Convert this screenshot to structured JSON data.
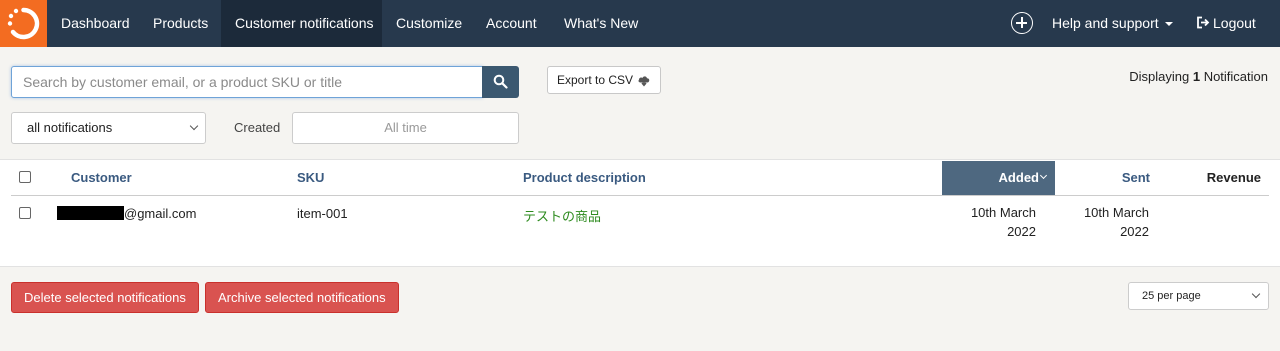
{
  "nav": {
    "items": [
      {
        "label": "Dashboard"
      },
      {
        "label": "Products"
      },
      {
        "label": "Customer notifications"
      },
      {
        "label": "Customize"
      },
      {
        "label": "Account"
      },
      {
        "label": "What's New"
      }
    ],
    "active_index": 2,
    "help_label": "Help and support",
    "logout_label": "Logout"
  },
  "toolbar": {
    "search_placeholder": "Search by customer email, or a product SKU or title",
    "export_label": "Export to CSV",
    "displaying_prefix": "Displaying",
    "displaying_count": "1",
    "displaying_suffix": "Notification"
  },
  "filters": {
    "notification_filter": "all notifications",
    "created_label": "Created",
    "date_range": "All time"
  },
  "table": {
    "columns": {
      "customer": "Customer",
      "sku": "SKU",
      "product_description": "Product description",
      "added": "Added",
      "sent": "Sent",
      "revenue": "Revenue"
    },
    "sorted_column": "added",
    "rows": [
      {
        "customer_email": "@gmail.com",
        "sku": "item-001",
        "product_description": "テストの商品",
        "added_line1": "10th March",
        "added_line2": "2022",
        "sent_line1": "10th March",
        "sent_line2": "2022",
        "revenue": ""
      }
    ]
  },
  "actions": {
    "delete_label": "Delete selected notifications",
    "archive_label": "Archive selected notifications",
    "per_page": "25 per page"
  },
  "colors": {
    "navbar": "#27394d",
    "logo": "#f36c21",
    "danger": "#d95350",
    "link": "#3a5a80",
    "product_link": "#2e8b1f"
  },
  "icons": {
    "logo": "brand-logo-icon",
    "search": "search-icon",
    "export": "cloud-download-icon",
    "add": "plus-circle-icon",
    "logout": "logout-icon"
  }
}
